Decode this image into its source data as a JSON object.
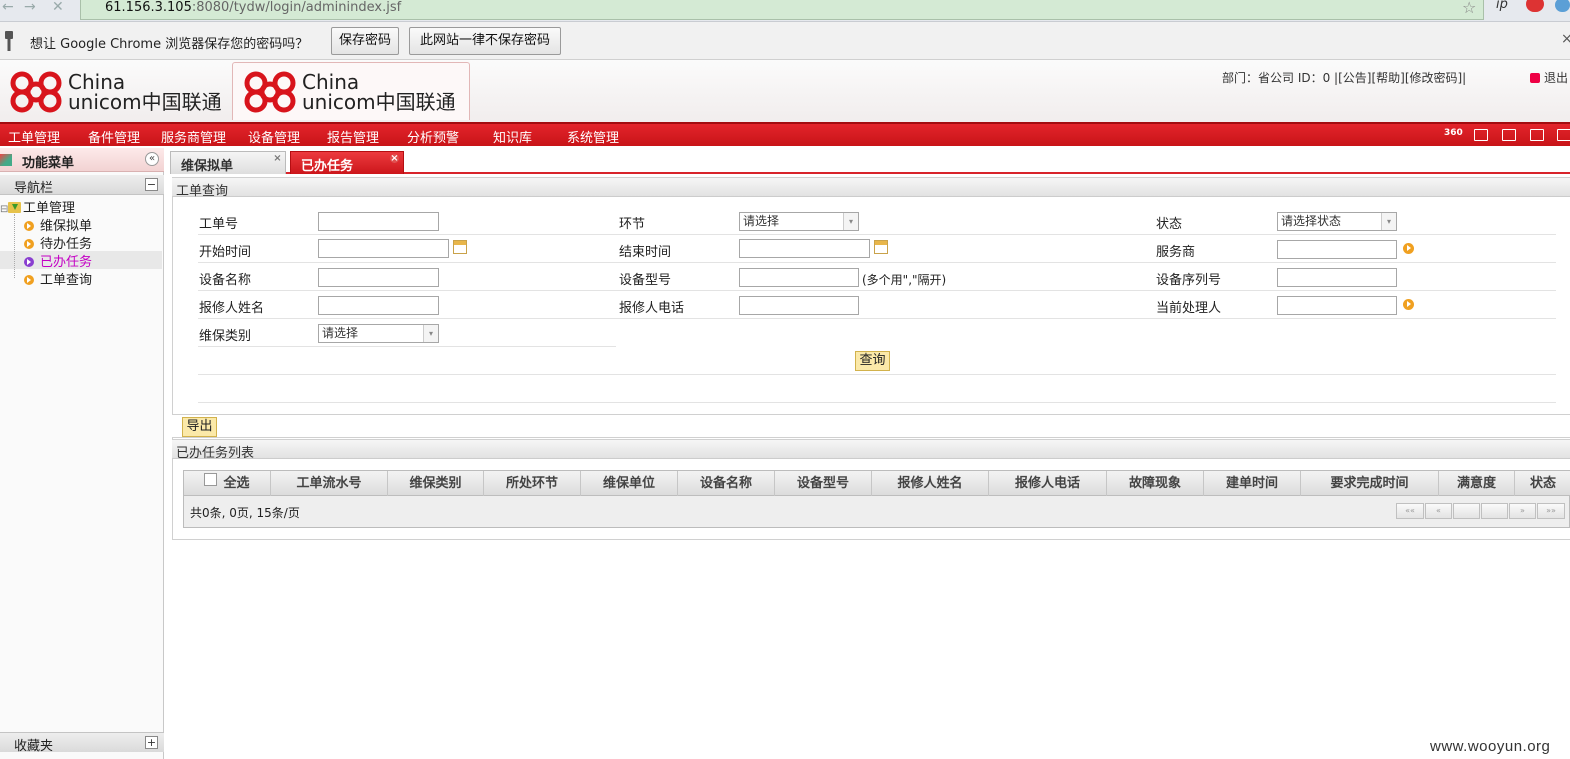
{
  "browser": {
    "url_host": "61.156.3.105",
    "url_rest": ":8080/tydw/login/adminindex.jsf",
    "ext1": "ip"
  },
  "password_bar": {
    "message": "想让 Google Chrome 浏览器保存您的密码吗？",
    "save_label": "保存密码",
    "never_label": "此网站一律不保存密码",
    "close": "×"
  },
  "header": {
    "logo_line1": "China",
    "logo_line2": "unicom中国联通",
    "user_info": "部门：省公司  ID：0  |[公告][帮助][修改密码]|",
    "logout": "退出"
  },
  "menu": [
    "工单管理",
    "备件管理",
    "服务商管理",
    "设备管理",
    "报告管理",
    "分析预警",
    "知识库",
    "系统管理"
  ],
  "toolbar": {
    "badge_360": "360"
  },
  "left": {
    "func_title": "功能菜单",
    "collapse": "«",
    "nav_title": "导航栏",
    "nav_toggle": "−",
    "tree_root": "工单管理",
    "tree_items": [
      "维保拟单",
      "待办任务",
      "已办任务",
      "工单查询"
    ],
    "fav_title": "收藏夹",
    "fav_toggle": "+"
  },
  "tabs": [
    {
      "label": "维保拟单",
      "close": "×"
    },
    {
      "label": "已办任务",
      "close": "×"
    }
  ],
  "query": {
    "section_title": "工单查询",
    "labels": {
      "order_no": "工单号",
      "stage": "环节",
      "status": "状态",
      "start_time": "开始时间",
      "end_time": "结束时间",
      "provider": "服务商",
      "device_name": "设备名称",
      "device_model": "设备型号",
      "device_serial": "设备序列号",
      "reporter_name": "报修人姓名",
      "reporter_phone": "报修人电话",
      "handler": "当前处理人",
      "maint_type": "维保类别"
    },
    "selects": {
      "stage": "请选择",
      "status": "请选择状态",
      "maint_type": "请选择",
      "arrow": "▾"
    },
    "model_hint": "(多个用\",\"隔开)",
    "search_label": "查询"
  },
  "list": {
    "export_label": "导出",
    "section_title": "已办任务列表",
    "columns": [
      "全选",
      "工单流水号",
      "维保类别",
      "所处环节",
      "维保单位",
      "设备名称",
      "设备型号",
      "报修人姓名",
      "报修人电话",
      "故障现象",
      "建单时间",
      "要求完成时间",
      "满意度",
      "状态"
    ],
    "pager_text": "共0条, 0页, 15条/页",
    "pager_buttons": [
      "««",
      "«",
      "",
      "",
      "»",
      "»»"
    ]
  },
  "watermark": "www.wooyun.org"
}
